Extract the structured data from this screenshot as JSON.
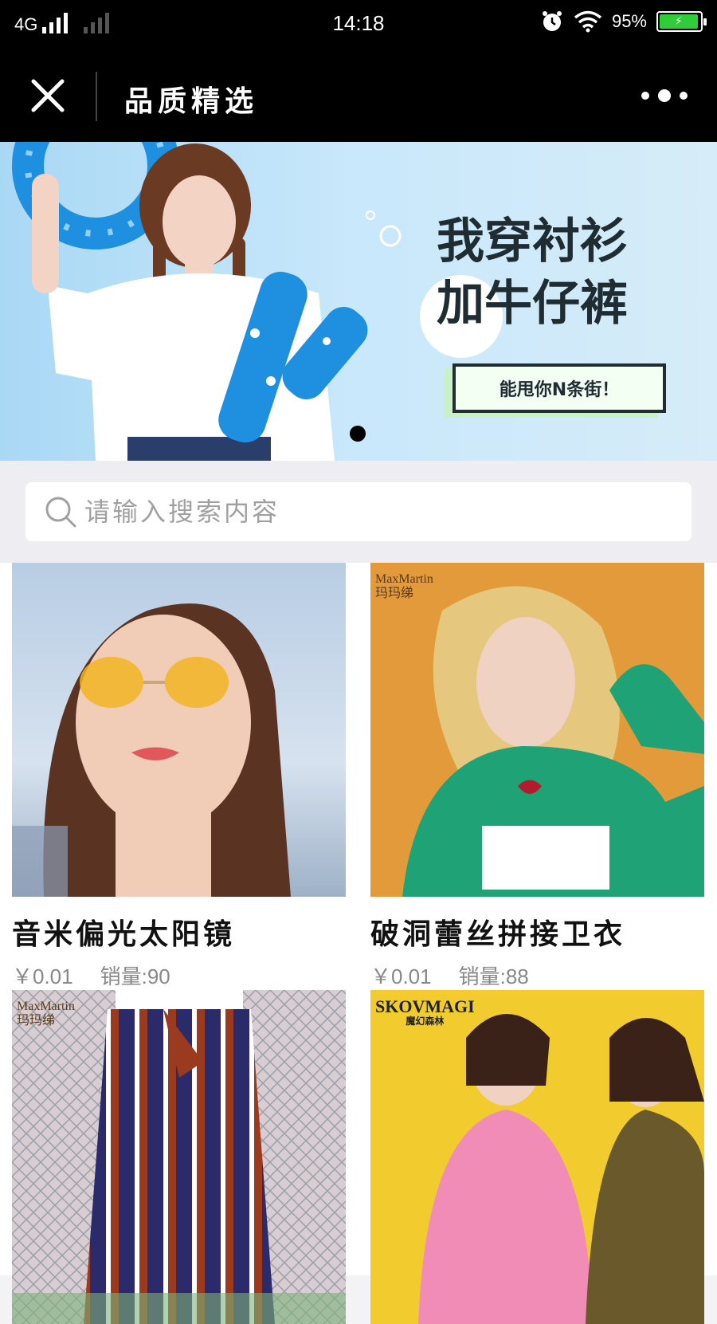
{
  "status_bar": {
    "network": "4G",
    "time": "14:18",
    "battery_percent": "95%",
    "battery_level": 0.95
  },
  "nav": {
    "title": "品质精选"
  },
  "banner": {
    "headline_line1": "我穿衬衫",
    "headline_line2": "加牛仔裤",
    "tag": "能甩你N条街！",
    "active_slide": 1,
    "slide_count": 1
  },
  "search": {
    "placeholder": "请输入搜索内容"
  },
  "products": [
    {
      "name": "音米偏光太阳镜",
      "price": "￥0.01",
      "sales": "销量:90"
    },
    {
      "name": "破洞蕾丝拼接卫衣",
      "price": "￥0.01",
      "sales": "销量:88",
      "brand_line1": "MaxMartin",
      "brand_line2": "玛玛绨"
    },
    {
      "name": "",
      "price": "",
      "sales": "",
      "brand_line1": "MaxMartin",
      "brand_line2": "玛玛绨"
    },
    {
      "name": "",
      "price": "",
      "sales": "",
      "brand_line1": "SKOVMAGI",
      "brand_line2": "魔幻森林"
    }
  ],
  "colors": {
    "nav_bg": "#000000",
    "battery_fill": "#2fcd3a",
    "price_text": "#888888"
  }
}
